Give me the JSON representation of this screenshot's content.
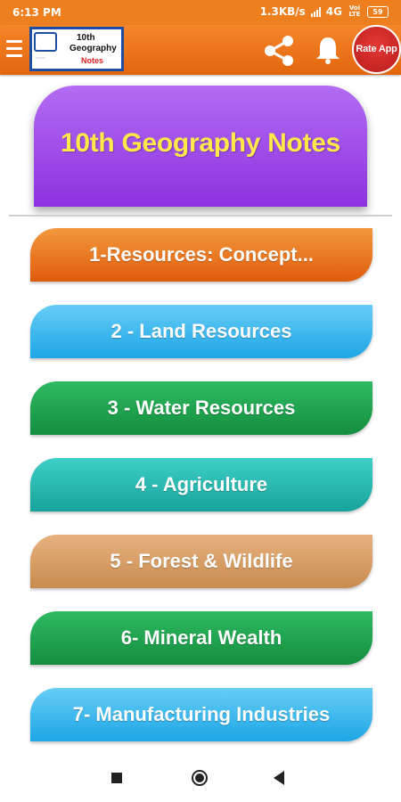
{
  "status_bar": {
    "time": "6:13 PM",
    "network_speed": "1.3KB/s",
    "network_type": "4G",
    "volte": "Voi LTE",
    "battery": "59"
  },
  "toolbar": {
    "logo": {
      "line1": "10th",
      "line2": "Geography",
      "line3": "Notes"
    },
    "rate_label": "Rate App"
  },
  "title": "10th Geography Notes",
  "chapters": [
    {
      "label": "1-Resources: Concept...",
      "color": "#ea7a1e"
    },
    {
      "label": "2 - Land Resources",
      "color": "#3bb8ee"
    },
    {
      "label": "3 - Water Resources",
      "color": "#21a34f"
    },
    {
      "label": "4 - Agriculture",
      "color": "#28b9b0"
    },
    {
      "label": "5 - Forest & Wildlife",
      "color": "#d9a067"
    },
    {
      "label": "6- Mineral Wealth",
      "color": "#21a34f"
    },
    {
      "label": "7- Manufacturing Industries",
      "color": "#3bb8ee"
    }
  ],
  "colors": {
    "toolbar": "#f07a20",
    "title_card": "#a050ea",
    "title_text": "#ffe94a",
    "rate_button": "#d32f2f"
  },
  "icons": [
    "menu-icon",
    "share-icon",
    "bell-icon",
    "recent-apps-icon",
    "home-icon",
    "back-icon"
  ]
}
